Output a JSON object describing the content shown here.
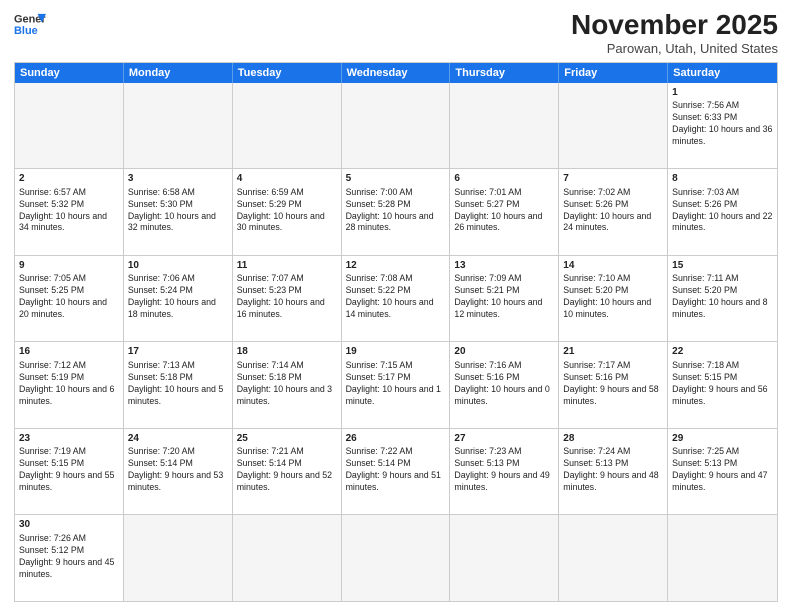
{
  "header": {
    "logo_general": "General",
    "logo_blue": "Blue",
    "month_title": "November 2025",
    "location": "Parowan, Utah, United States"
  },
  "days_of_week": [
    "Sunday",
    "Monday",
    "Tuesday",
    "Wednesday",
    "Thursday",
    "Friday",
    "Saturday"
  ],
  "weeks": [
    [
      {
        "day": "",
        "info": ""
      },
      {
        "day": "",
        "info": ""
      },
      {
        "day": "",
        "info": ""
      },
      {
        "day": "",
        "info": ""
      },
      {
        "day": "",
        "info": ""
      },
      {
        "day": "",
        "info": ""
      },
      {
        "day": "1",
        "info": "Sunrise: 7:56 AM\nSunset: 6:33 PM\nDaylight: 10 hours and 36 minutes."
      }
    ],
    [
      {
        "day": "2",
        "info": "Sunrise: 6:57 AM\nSunset: 5:32 PM\nDaylight: 10 hours and 34 minutes."
      },
      {
        "day": "3",
        "info": "Sunrise: 6:58 AM\nSunset: 5:30 PM\nDaylight: 10 hours and 32 minutes."
      },
      {
        "day": "4",
        "info": "Sunrise: 6:59 AM\nSunset: 5:29 PM\nDaylight: 10 hours and 30 minutes."
      },
      {
        "day": "5",
        "info": "Sunrise: 7:00 AM\nSunset: 5:28 PM\nDaylight: 10 hours and 28 minutes."
      },
      {
        "day": "6",
        "info": "Sunrise: 7:01 AM\nSunset: 5:27 PM\nDaylight: 10 hours and 26 minutes."
      },
      {
        "day": "7",
        "info": "Sunrise: 7:02 AM\nSunset: 5:26 PM\nDaylight: 10 hours and 24 minutes."
      },
      {
        "day": "8",
        "info": "Sunrise: 7:03 AM\nSunset: 5:26 PM\nDaylight: 10 hours and 22 minutes."
      }
    ],
    [
      {
        "day": "9",
        "info": "Sunrise: 7:05 AM\nSunset: 5:25 PM\nDaylight: 10 hours and 20 minutes."
      },
      {
        "day": "10",
        "info": "Sunrise: 7:06 AM\nSunset: 5:24 PM\nDaylight: 10 hours and 18 minutes."
      },
      {
        "day": "11",
        "info": "Sunrise: 7:07 AM\nSunset: 5:23 PM\nDaylight: 10 hours and 16 minutes."
      },
      {
        "day": "12",
        "info": "Sunrise: 7:08 AM\nSunset: 5:22 PM\nDaylight: 10 hours and 14 minutes."
      },
      {
        "day": "13",
        "info": "Sunrise: 7:09 AM\nSunset: 5:21 PM\nDaylight: 10 hours and 12 minutes."
      },
      {
        "day": "14",
        "info": "Sunrise: 7:10 AM\nSunset: 5:20 PM\nDaylight: 10 hours and 10 minutes."
      },
      {
        "day": "15",
        "info": "Sunrise: 7:11 AM\nSunset: 5:20 PM\nDaylight: 10 hours and 8 minutes."
      }
    ],
    [
      {
        "day": "16",
        "info": "Sunrise: 7:12 AM\nSunset: 5:19 PM\nDaylight: 10 hours and 6 minutes."
      },
      {
        "day": "17",
        "info": "Sunrise: 7:13 AM\nSunset: 5:18 PM\nDaylight: 10 hours and 5 minutes."
      },
      {
        "day": "18",
        "info": "Sunrise: 7:14 AM\nSunset: 5:18 PM\nDaylight: 10 hours and 3 minutes."
      },
      {
        "day": "19",
        "info": "Sunrise: 7:15 AM\nSunset: 5:17 PM\nDaylight: 10 hours and 1 minute."
      },
      {
        "day": "20",
        "info": "Sunrise: 7:16 AM\nSunset: 5:16 PM\nDaylight: 10 hours and 0 minutes."
      },
      {
        "day": "21",
        "info": "Sunrise: 7:17 AM\nSunset: 5:16 PM\nDaylight: 9 hours and 58 minutes."
      },
      {
        "day": "22",
        "info": "Sunrise: 7:18 AM\nSunset: 5:15 PM\nDaylight: 9 hours and 56 minutes."
      }
    ],
    [
      {
        "day": "23",
        "info": "Sunrise: 7:19 AM\nSunset: 5:15 PM\nDaylight: 9 hours and 55 minutes."
      },
      {
        "day": "24",
        "info": "Sunrise: 7:20 AM\nSunset: 5:14 PM\nDaylight: 9 hours and 53 minutes."
      },
      {
        "day": "25",
        "info": "Sunrise: 7:21 AM\nSunset: 5:14 PM\nDaylight: 9 hours and 52 minutes."
      },
      {
        "day": "26",
        "info": "Sunrise: 7:22 AM\nSunset: 5:14 PM\nDaylight: 9 hours and 51 minutes."
      },
      {
        "day": "27",
        "info": "Sunrise: 7:23 AM\nSunset: 5:13 PM\nDaylight: 9 hours and 49 minutes."
      },
      {
        "day": "28",
        "info": "Sunrise: 7:24 AM\nSunset: 5:13 PM\nDaylight: 9 hours and 48 minutes."
      },
      {
        "day": "29",
        "info": "Sunrise: 7:25 AM\nSunset: 5:13 PM\nDaylight: 9 hours and 47 minutes."
      }
    ],
    [
      {
        "day": "30",
        "info": "Sunrise: 7:26 AM\nSunset: 5:12 PM\nDaylight: 9 hours and 45 minutes."
      },
      {
        "day": "",
        "info": ""
      },
      {
        "day": "",
        "info": ""
      },
      {
        "day": "",
        "info": ""
      },
      {
        "day": "",
        "info": ""
      },
      {
        "day": "",
        "info": ""
      },
      {
        "day": "",
        "info": ""
      }
    ]
  ]
}
